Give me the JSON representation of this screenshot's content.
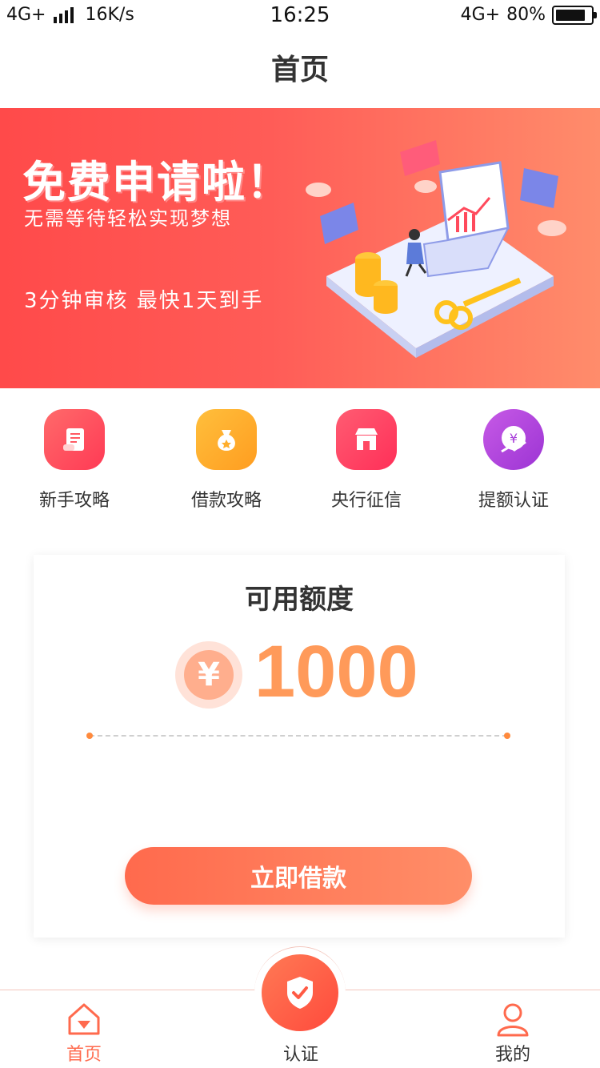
{
  "status_bar": {
    "network_left": "4G+",
    "speed": "16K/s",
    "time": "16:25",
    "network_right": "4G+",
    "battery": "80%"
  },
  "page_title": "首页",
  "banner": {
    "headline": "免费申请啦！",
    "subtitle": "无需等待轻松实现梦想",
    "promo": "3分钟审核 最快1天到手"
  },
  "quick_links": [
    {
      "label": "新手攻略",
      "icon": "scroll-icon",
      "color": "#ff4a5c"
    },
    {
      "label": "借款攻略",
      "icon": "money-bag-icon",
      "color": "#ffa92c"
    },
    {
      "label": "央行征信",
      "icon": "bank-store-icon",
      "color": "#ff3f63"
    },
    {
      "label": "提额认证",
      "icon": "yen-growth-icon",
      "color": "#b93fd8"
    }
  ],
  "credit": {
    "title": "可用额度",
    "currency_symbol": "¥",
    "amount": "1000",
    "button": "立即借款"
  },
  "tabs": {
    "home": "首页",
    "verify": "认证",
    "mine": "我的"
  },
  "colors": {
    "accent": "#ff6a4d",
    "amount": "#ff9a5a",
    "tab_active": "#ff6a4d"
  }
}
